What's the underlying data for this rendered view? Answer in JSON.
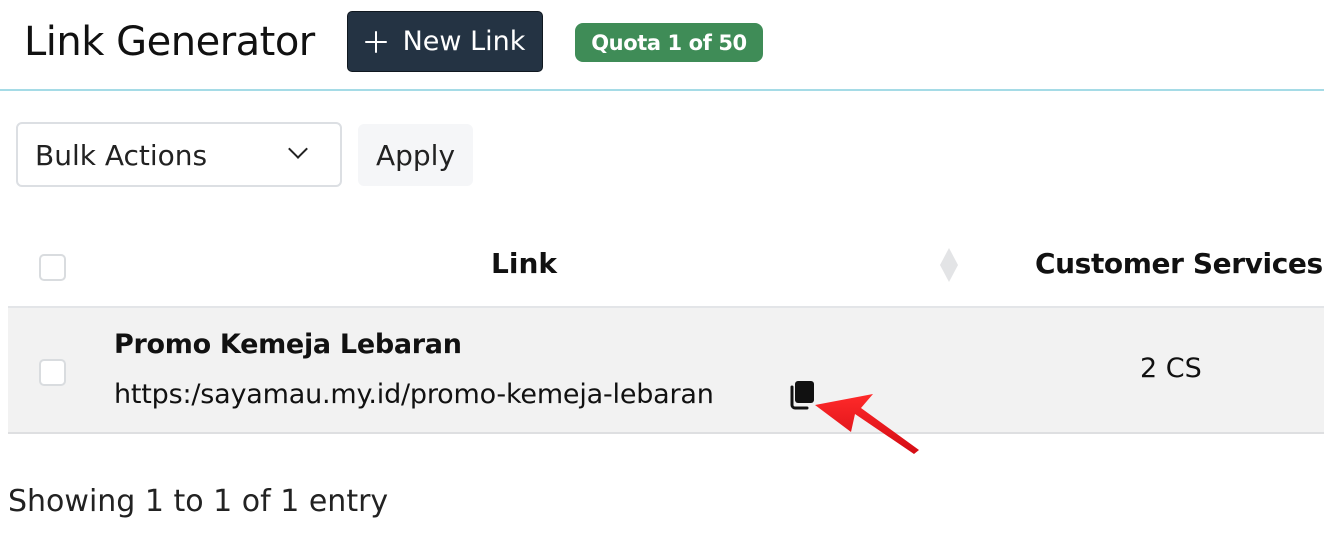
{
  "header": {
    "title": "Link Generator",
    "new_link_label": "New Link",
    "quota_label": "Quota 1 of 50"
  },
  "toolbar": {
    "bulk_actions_value": "Bulk Actions",
    "apply_label": "Apply"
  },
  "table": {
    "columns": [
      "Link",
      "Customer Services"
    ],
    "rows": [
      {
        "name": "Promo Kemeja Lebaran",
        "url": "https:/sayamau.my.id/promo-kemeja-lebaran",
        "customer_services": "2 CS"
      }
    ]
  },
  "footer": {
    "info": "Showing 1 to 1 of 1 entry"
  },
  "colors": {
    "new_link_bg": "#243343",
    "quota_badge_bg": "#3f8c57",
    "header_divider": "#a5dbe6",
    "row_bg": "#f2f2f2",
    "annotation_arrow": "#e8121b"
  },
  "icons": {
    "plus": "plus-icon",
    "chevron": "chevron-down-icon",
    "sort": "sort-icon",
    "copy": "copy-icon",
    "annotation": "pointer-arrow-annotation"
  }
}
